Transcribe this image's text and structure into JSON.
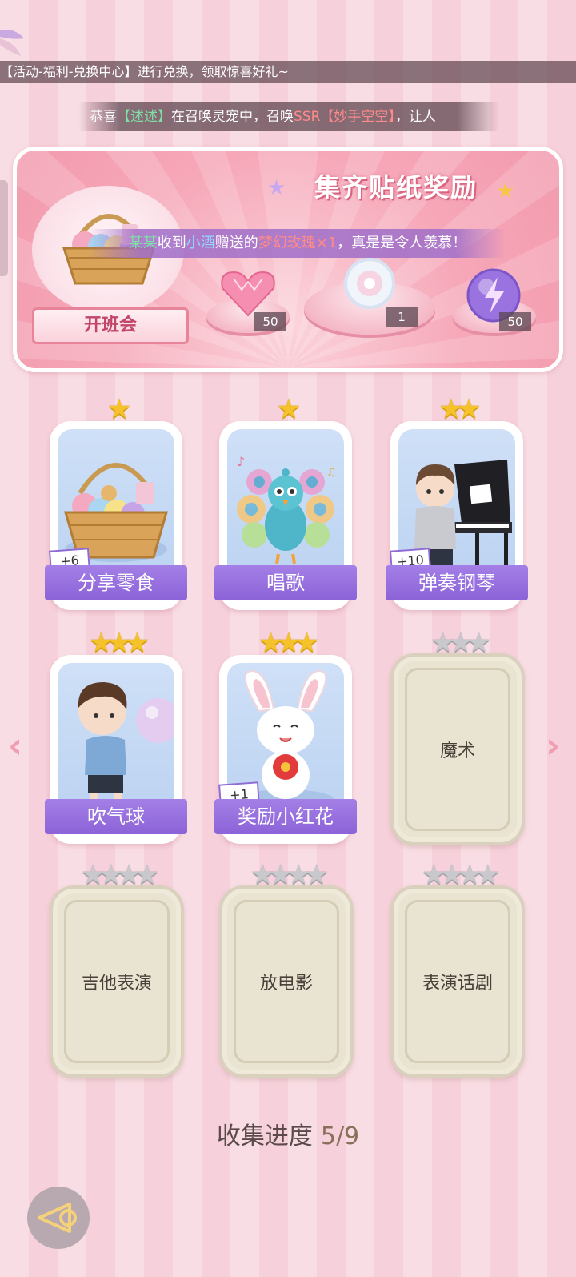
{
  "top": {
    "marquee_line": "【活动-福利-兑换中心】进行兑换，领取惊喜好礼~",
    "broadcast": {
      "prefix": "恭喜",
      "user": "【述述】",
      "mid": "在召唤灵宠中，召唤",
      "item": "SSR【妙手空空】",
      "suffix": "，让人"
    }
  },
  "banner": {
    "title": "集齐贴纸奖励",
    "notice": {
      "part1": "某某",
      "part2": "收到",
      "part3": "小酒",
      "part4": "赠送的",
      "part5": "梦幻玫瑰×1",
      "part6": "，真是是令人羡慕！"
    },
    "event_label": "开班会",
    "rewards": [
      {
        "name": "heart-gem",
        "count": "50"
      },
      {
        "name": "crystal-bouquet",
        "count": "1"
      },
      {
        "name": "lightning-orb",
        "count": "50"
      }
    ]
  },
  "cards": [
    {
      "label": "分享零食",
      "stars": 1,
      "bonus": "+6",
      "unlocked": true
    },
    {
      "label": "唱歌",
      "stars": 1,
      "bonus": "",
      "unlocked": true
    },
    {
      "label": "弹奏钢琴",
      "stars": 2,
      "bonus": "+10",
      "unlocked": true
    },
    {
      "label": "吹气球",
      "stars": 3,
      "bonus": "",
      "unlocked": true
    },
    {
      "label": "奖励小红花",
      "stars": 3,
      "bonus": "+1",
      "unlocked": true
    },
    {
      "label": "魔术",
      "stars": 3,
      "bonus": "",
      "unlocked": false
    },
    {
      "label": "吉他表演",
      "stars": 4,
      "bonus": "",
      "unlocked": false
    },
    {
      "label": "放电影",
      "stars": 4,
      "bonus": "",
      "unlocked": false
    },
    {
      "label": "表演话剧",
      "stars": 4,
      "bonus": "",
      "unlocked": false
    }
  ],
  "progress": {
    "label": "收集进度",
    "value": "5/9"
  },
  "colors": {
    "accent_purple": "#8c63d8",
    "gold_star": "#f5c22c",
    "pink": "#f29bae"
  }
}
